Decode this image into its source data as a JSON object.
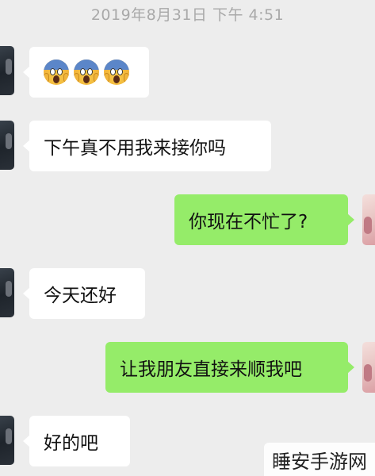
{
  "timestamp": "2019年8月31日 下午 4:51",
  "messages": [
    {
      "side": "left",
      "type": "emoji",
      "icon": "screaming-face-emoji",
      "count": 3
    },
    {
      "side": "left",
      "type": "text",
      "text": "下午真不用我来接你吗"
    },
    {
      "side": "right",
      "type": "text",
      "text": "你现在不忙了?"
    },
    {
      "side": "left",
      "type": "text",
      "text": "今天还好"
    },
    {
      "side": "right",
      "type": "text",
      "text": "让我朋友直接来顺我吧"
    },
    {
      "side": "left",
      "type": "text",
      "text": "好的吧"
    }
  ],
  "watermark": "睡安手游网",
  "colors": {
    "background": "#ededed",
    "incoming_bubble": "#ffffff",
    "outgoing_bubble": "#95ec69",
    "timestamp_text": "#a9a9a9"
  }
}
